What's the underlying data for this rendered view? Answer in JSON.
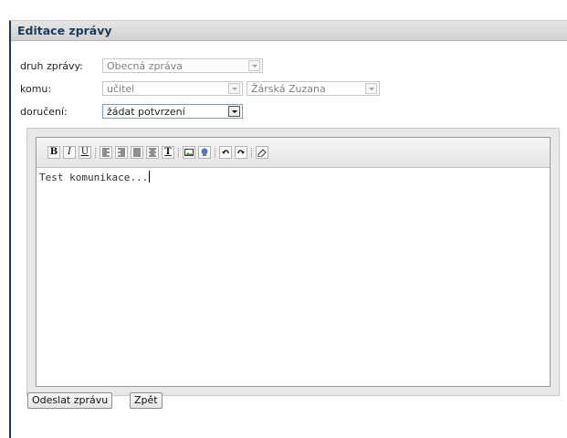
{
  "panel": {
    "title": "Editace zprávy"
  },
  "form": {
    "type": {
      "label": "druh zprávy:",
      "value": "Obecná zpráva"
    },
    "recipient": {
      "label": "komu:",
      "group_value": "učitel",
      "person_value": "Žárská Zuzana"
    },
    "delivery": {
      "label": "doručení:",
      "value": "žádat potvrzení"
    }
  },
  "editor": {
    "content": "Test komunikace...",
    "toolbar": {
      "bold": "B",
      "italic": "I",
      "underline": "U",
      "text_color": "T"
    }
  },
  "actions": {
    "send_label": "Odeslat zprávu",
    "back_label": "Zpět"
  }
}
